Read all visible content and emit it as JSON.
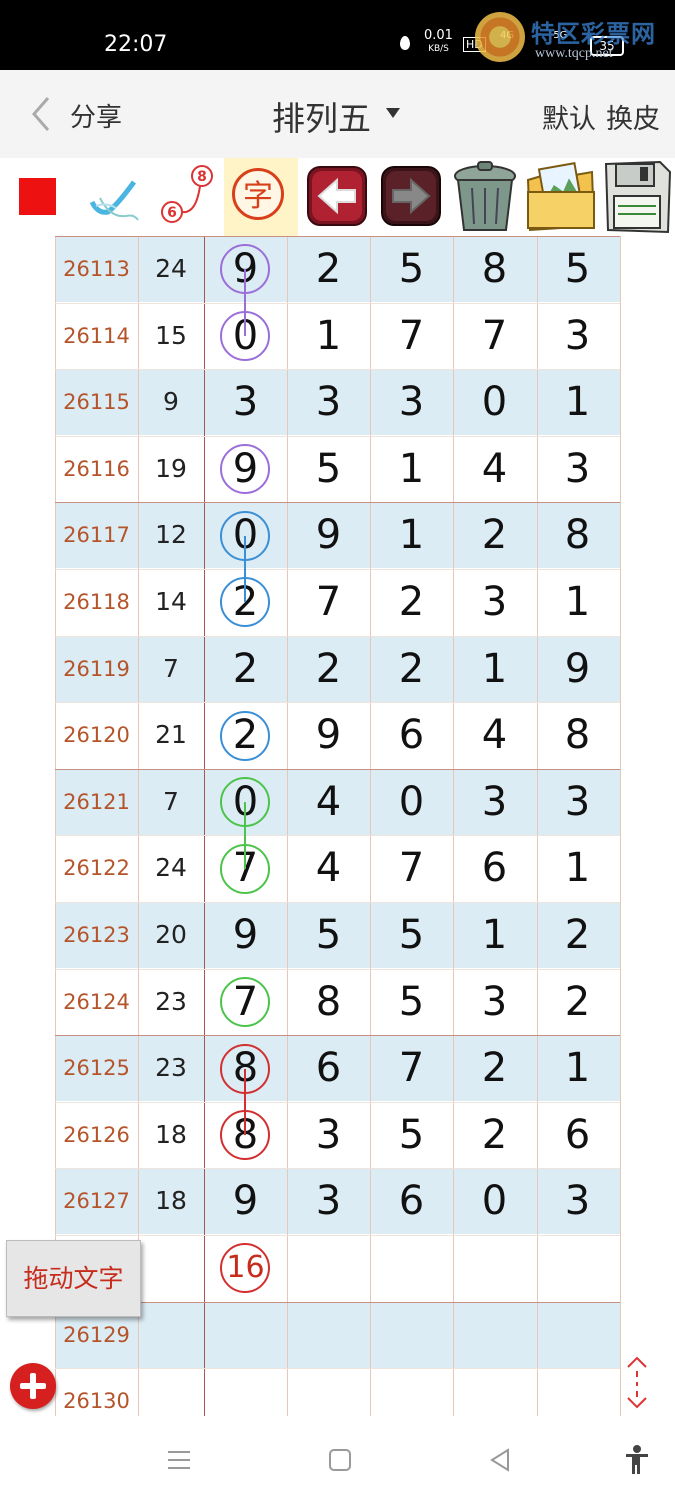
{
  "status_bar": {
    "time": "22:07",
    "net_speed": "0.01",
    "net_unit": "KB/S",
    "hd": "HD",
    "net_type": "4G",
    "net_type2": "5G",
    "battery": "35"
  },
  "watermark": {
    "name": "特区彩票网",
    "url": "www.tqcp.net"
  },
  "header": {
    "share": "分享",
    "title": "排列五",
    "default": "默认",
    "skin": "换皮"
  },
  "toolbar": {
    "zi": "字",
    "connector_top": "8",
    "connector_bottom": "6"
  },
  "rows": [
    {
      "issue": "26113",
      "sum": "24",
      "d": [
        "9",
        "2",
        "5",
        "8",
        "5"
      ]
    },
    {
      "issue": "26114",
      "sum": "15",
      "d": [
        "0",
        "1",
        "7",
        "7",
        "3"
      ]
    },
    {
      "issue": "26115",
      "sum": "9",
      "d": [
        "3",
        "3",
        "3",
        "0",
        "1"
      ]
    },
    {
      "issue": "26116",
      "sum": "19",
      "d": [
        "9",
        "5",
        "1",
        "4",
        "3"
      ]
    },
    {
      "issue": "26117",
      "sum": "12",
      "d": [
        "0",
        "9",
        "1",
        "2",
        "8"
      ]
    },
    {
      "issue": "26118",
      "sum": "14",
      "d": [
        "2",
        "7",
        "2",
        "3",
        "1"
      ]
    },
    {
      "issue": "26119",
      "sum": "7",
      "d": [
        "2",
        "2",
        "2",
        "1",
        "9"
      ]
    },
    {
      "issue": "26120",
      "sum": "21",
      "d": [
        "2",
        "9",
        "6",
        "4",
        "8"
      ]
    },
    {
      "issue": "26121",
      "sum": "7",
      "d": [
        "0",
        "4",
        "0",
        "3",
        "3"
      ]
    },
    {
      "issue": "26122",
      "sum": "24",
      "d": [
        "7",
        "4",
        "7",
        "6",
        "1"
      ]
    },
    {
      "issue": "26123",
      "sum": "20",
      "d": [
        "9",
        "5",
        "5",
        "1",
        "2"
      ]
    },
    {
      "issue": "26124",
      "sum": "23",
      "d": [
        "7",
        "8",
        "5",
        "3",
        "2"
      ]
    },
    {
      "issue": "26125",
      "sum": "23",
      "d": [
        "8",
        "6",
        "7",
        "2",
        "1"
      ]
    },
    {
      "issue": "26126",
      "sum": "18",
      "d": [
        "8",
        "3",
        "5",
        "2",
        "6"
      ]
    },
    {
      "issue": "26127",
      "sum": "18",
      "d": [
        "9",
        "3",
        "6",
        "0",
        "3"
      ]
    },
    {
      "issue": "",
      "sum": "",
      "d": [
        "16",
        "",
        "",
        "",
        ""
      ]
    },
    {
      "issue": "26129",
      "sum": "",
      "d": [
        "",
        "",
        "",
        "",
        ""
      ]
    },
    {
      "issue": "26130",
      "sum": "",
      "d": [
        "",
        "",
        "",
        "",
        ""
      ]
    }
  ],
  "marks": [
    {
      "row": 0,
      "color": "#9b6fd9"
    },
    {
      "row": 1,
      "color": "#9b6fd9"
    },
    {
      "row": 3,
      "color": "#9b6fd9"
    },
    {
      "row": 4,
      "color": "#3a8fd6"
    },
    {
      "row": 5,
      "color": "#3a8fd6"
    },
    {
      "row": 7,
      "color": "#3a8fd6"
    },
    {
      "row": 8,
      "color": "#4cc44c"
    },
    {
      "row": 9,
      "color": "#4cc44c"
    },
    {
      "row": 11,
      "color": "#4cc44c"
    },
    {
      "row": 12,
      "color": "#d23030"
    },
    {
      "row": 13,
      "color": "#d23030"
    },
    {
      "row": 15,
      "color": "#d23030"
    }
  ],
  "links": [
    {
      "from": 0,
      "to": 1,
      "color": "#9b6fd9"
    },
    {
      "from": 4,
      "to": 5,
      "color": "#3a8fd6"
    },
    {
      "from": 8,
      "to": 9,
      "color": "#4cc44c"
    },
    {
      "from": 12,
      "to": 13,
      "color": "#d23030"
    }
  ],
  "float": {
    "drag_label": "拖动文字"
  },
  "colors": {
    "issue": "#b5542a",
    "band": "#dcecf4",
    "accent_red": "#ee1111"
  }
}
